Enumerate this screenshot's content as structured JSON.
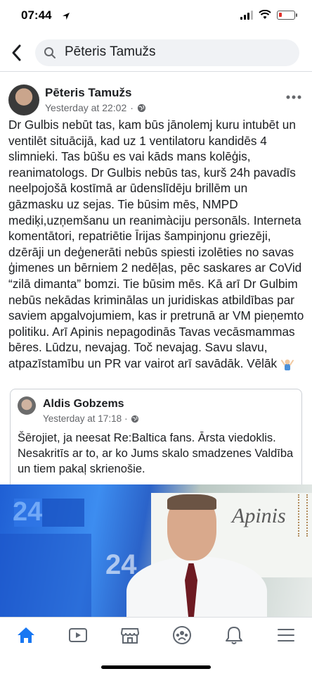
{
  "status": {
    "time": "07:44",
    "battery_level": 0.2
  },
  "search": {
    "query": "Pēteris Tamužs"
  },
  "post": {
    "author": "Pēteris Tamužs",
    "timestamp": "Yesterday at 22:02",
    "privacy_icon": "globe-icon",
    "body": "Dr Gulbis nebūt tas, kam būs jānolemj kuru intubēt un ventilēt situācijā, kad uz 1 ventilatoru kandidēs 4 slimnieki. Tas būšu es vai kāds mans kolēģis, reanimatologs. Dr Gulbis nebūs tas, kurš 24h pavadīs neelpojošā kostīmā ar ūdenslīdēju brillēm un gāzmasku uz sejas. Tie būsim mēs, NMPD mediķi,uzņemšanu un reanimàciju personāls. Interneta komentātori, repatriētie Īrijas šampinjonu griezēji, dzērāji un deģenerāti nebūs spiesti izolēties no savas ģimenes un bērniem 2 nedēļas, pēc saskares ar CoVid “zilā dimanta” bomzi. Tie būsim mēs. Kā arī Dr Gulbim nebūs nekādas kriminālas un juridiskas atbildības par saviem apgalvojumiem, kas ir pretrunā ar VM pieņemto politiku. Arī Apinis nepagodinās Tavas vecāsmammas bēres. Lūdzu, nevajag. Toč nevajag. Savu slavu, atpazīstamību un PR var vairot arī savādāk. Vēlāk",
    "body_emoji": "person-shrugging-emoji"
  },
  "shared": {
    "author": "Aldis Gobzems",
    "timestamp": "Yesterday at 17:18",
    "text": "Šērojiet, ja neesat Re:Baltica fans. Ārsta viedoklis. Nesakritīs ar to, ar ko Jums skalo smadzenes Valdība un tiem pakaļ skrienošie."
  },
  "video": {
    "studio_logo_text": "24",
    "brand_text": "Apinis"
  },
  "tabs": [
    {
      "name": "home-icon",
      "active": true
    },
    {
      "name": "video-icon",
      "active": false
    },
    {
      "name": "marketplace-icon",
      "active": false
    },
    {
      "name": "groups-icon",
      "active": false
    },
    {
      "name": "notifications-icon",
      "active": false
    },
    {
      "name": "menu-icon",
      "active": false
    }
  ],
  "colors": {
    "accent": "#1877f2",
    "text": "#1c1e21",
    "secondary_text": "#65676b"
  }
}
